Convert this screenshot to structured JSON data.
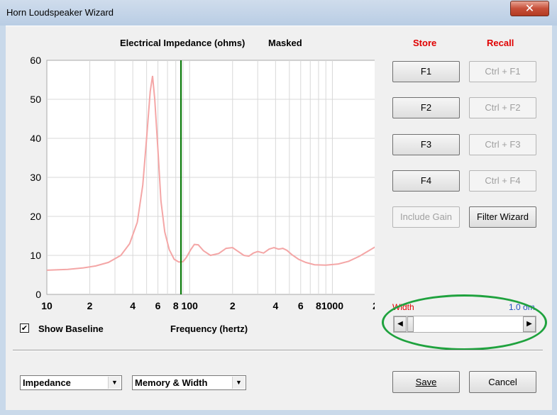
{
  "window": {
    "title": "Horn Loudspeaker Wizard",
    "close_glyph": "✕"
  },
  "chart_header": {
    "title": "Electrical Impedance (ohms)",
    "mask_label": "Masked"
  },
  "store_recall": {
    "store_label": "Store",
    "recall_label": "Recall",
    "store_buttons": [
      "F1",
      "F2",
      "F3",
      "F4"
    ],
    "recall_buttons": [
      "Ctrl + F1",
      "Ctrl + F2",
      "Ctrl + F3",
      "Ctrl + F4"
    ],
    "include_gain_label": "Include Gain",
    "filter_wizard_label": "Filter Wizard",
    "color": "#e00000"
  },
  "baseline": {
    "checked": true,
    "check_glyph": "✔",
    "label": "Show Baseline"
  },
  "xaxis_label": "Frequency (hertz)",
  "width_control": {
    "label": "Width",
    "value": "1.0 om",
    "left_arrow": "◀",
    "right_arrow": "▶",
    "position": 0.0
  },
  "dropdowns": {
    "measure": "Impedance",
    "mode": "Memory & Width",
    "arrow": "▼"
  },
  "actions": {
    "save_label": "Save",
    "cancel_label": "Cancel"
  },
  "chart_data": {
    "type": "line",
    "xscale": "log",
    "xlim": [
      10,
      2000
    ],
    "ylim": [
      0,
      60
    ],
    "yticks": [
      0,
      10,
      20,
      30,
      40,
      50,
      60
    ],
    "xtick_labels": [
      {
        "x": 10,
        "label": "10"
      },
      {
        "x": 20,
        "label": "2"
      },
      {
        "x": 40,
        "label": "4"
      },
      {
        "x": 60,
        "label": "6"
      },
      {
        "x": 80,
        "label": "8"
      },
      {
        "x": 100,
        "label": "100"
      },
      {
        "x": 200,
        "label": "2"
      },
      {
        "x": 400,
        "label": "4"
      },
      {
        "x": 600,
        "label": "6"
      },
      {
        "x": 800,
        "label": "8"
      },
      {
        "x": 1000,
        "label": "1000"
      },
      {
        "x": 2000,
        "label": "2"
      }
    ],
    "grid": true,
    "marker_x": 87,
    "marker_color": "#0a7a0a",
    "series": [
      {
        "color": "#f4a6a6",
        "points": [
          [
            10,
            6.2
          ],
          [
            14,
            6.4
          ],
          [
            18,
            6.8
          ],
          [
            22,
            7.3
          ],
          [
            27,
            8.2
          ],
          [
            33,
            10.0
          ],
          [
            38,
            13.0
          ],
          [
            43,
            18.5
          ],
          [
            47,
            28.0
          ],
          [
            50,
            40.0
          ],
          [
            53,
            52.0
          ],
          [
            55,
            56.0
          ],
          [
            57,
            50.0
          ],
          [
            60,
            37.0
          ],
          [
            63,
            24.0
          ],
          [
            67,
            16.0
          ],
          [
            72,
            11.5
          ],
          [
            78,
            9.0
          ],
          [
            84,
            8.3
          ],
          [
            90,
            8.4
          ],
          [
            95,
            9.5
          ],
          [
            102,
            11.5
          ],
          [
            108,
            12.8
          ],
          [
            115,
            12.7
          ],
          [
            125,
            11.2
          ],
          [
            140,
            10.0
          ],
          [
            160,
            10.5
          ],
          [
            180,
            11.8
          ],
          [
            200,
            12.0
          ],
          [
            215,
            11.2
          ],
          [
            240,
            10.0
          ],
          [
            260,
            9.8
          ],
          [
            280,
            10.6
          ],
          [
            300,
            11.0
          ],
          [
            330,
            10.6
          ],
          [
            360,
            11.6
          ],
          [
            390,
            12.0
          ],
          [
            420,
            11.6
          ],
          [
            450,
            11.8
          ],
          [
            480,
            11.3
          ],
          [
            520,
            10.2
          ],
          [
            580,
            9.0
          ],
          [
            650,
            8.2
          ],
          [
            750,
            7.6
          ],
          [
            900,
            7.5
          ],
          [
            1100,
            7.8
          ],
          [
            1300,
            8.5
          ],
          [
            1550,
            9.8
          ],
          [
            1800,
            11.2
          ],
          [
            2000,
            12.2
          ]
        ]
      }
    ]
  }
}
